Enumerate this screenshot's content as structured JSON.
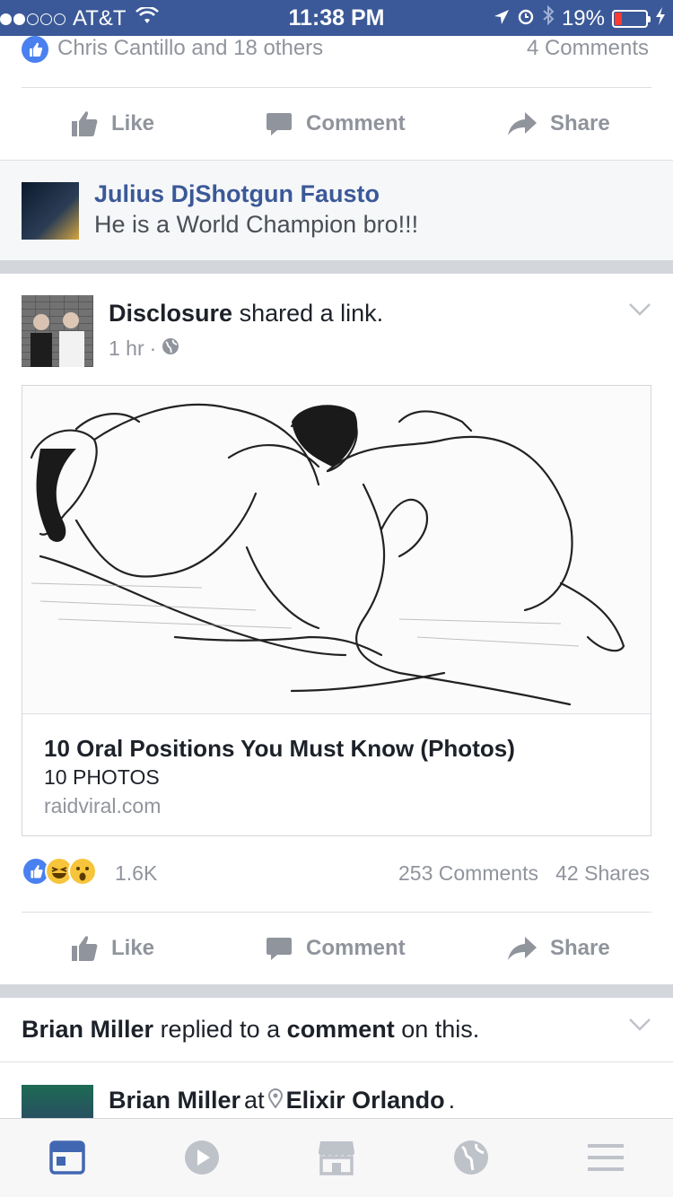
{
  "status_bar": {
    "carrier": "AT&T",
    "time": "11:38 PM",
    "battery": "19%"
  },
  "prev_post": {
    "reactions_text": "Chris Cantillo and 18 others",
    "comments_text": "4 Comments",
    "actions": {
      "like": "Like",
      "comment": "Comment",
      "share": "Share"
    },
    "comment": {
      "author": "Julius DjShotgun Fausto",
      "text": "He is a World Champion bro!!!"
    }
  },
  "post": {
    "author": "Disclosure",
    "action_text": "shared a link.",
    "time": "1 hr",
    "separator": "·",
    "link": {
      "title": "10 Oral Positions You Must Know (Photos)",
      "subtitle": "10 PHOTOS",
      "domain": "raidviral.com"
    },
    "reactions_count": "1.6K",
    "comments": "253 Comments",
    "shares": "42 Shares",
    "actions": {
      "like": "Like",
      "comment": "Comment",
      "share": "Share"
    }
  },
  "notification": {
    "name": "Brian Miller",
    "middle": "replied to a",
    "bold2": "comment",
    "end": "on this."
  },
  "next_post": {
    "author": "Brian Miller",
    "at": "at",
    "place": "Elixir Orlando",
    "period": "."
  },
  "tab_bar": {
    "icons": [
      "news-feed-icon",
      "video-icon",
      "marketplace-icon",
      "notifications-globe-icon",
      "menu-icon"
    ],
    "active_color": "#4267b2",
    "inactive_color": "#bec2c9"
  }
}
